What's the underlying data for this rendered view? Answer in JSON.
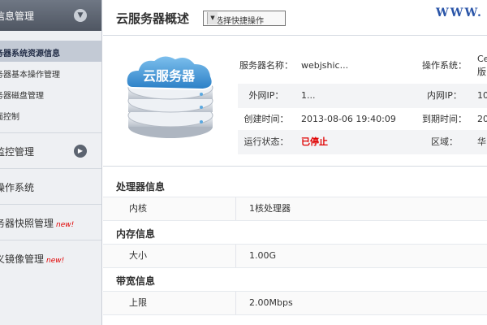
{
  "sidebar": {
    "section_title": "信息管理",
    "sub_items": [
      {
        "label": "务器系统资源信息",
        "active": true
      },
      {
        "label": "务器基本操作管理",
        "active": false
      },
      {
        "label": "务器磁盘管理",
        "active": false
      },
      {
        "label": "面控制",
        "active": false
      }
    ],
    "menu_items": [
      {
        "label": "监控管理",
        "badge": ""
      },
      {
        "label": "操作系统",
        "badge": ""
      },
      {
        "label": "务器快照管理",
        "badge": "new!"
      },
      {
        "label": "义镜像管理",
        "badge": "new!"
      }
    ]
  },
  "header": {
    "title": "云服务器概述",
    "quick_select": "请选择快捷操作",
    "brand": "WWW. V"
  },
  "server_art_text": "云服务器",
  "info": {
    "server_name_label": "服务器名称：",
    "server_name_value": "webjshic...",
    "os_label": "操作系统：",
    "os_value": "Ce",
    "os_value_line2": "版",
    "public_ip_label": "外网IP：",
    "public_ip_value": "1...",
    "private_ip_label": "内网IP：",
    "private_ip_value": "10",
    "created_label": "创建时间：",
    "created_value": "2013-08-06 19:40:09",
    "expire_label": "到期时间：",
    "expire_value": "20",
    "status_label": "运行状态：",
    "status_value": "已停止",
    "region_label": "区域：",
    "region_value": "华"
  },
  "details": {
    "cpu": {
      "title": "处理器信息",
      "label": "内核",
      "value": "1核处理器"
    },
    "memory": {
      "title": "内存信息",
      "label": "大小",
      "value": "1.00G"
    },
    "bandwidth": {
      "title": "带宽信息",
      "label": "上限",
      "value": "2.00Mbps"
    }
  },
  "colors": {
    "status_stopped": "#e00000",
    "brand": "#2a55a8",
    "sidebar_header": "#5b626e"
  }
}
